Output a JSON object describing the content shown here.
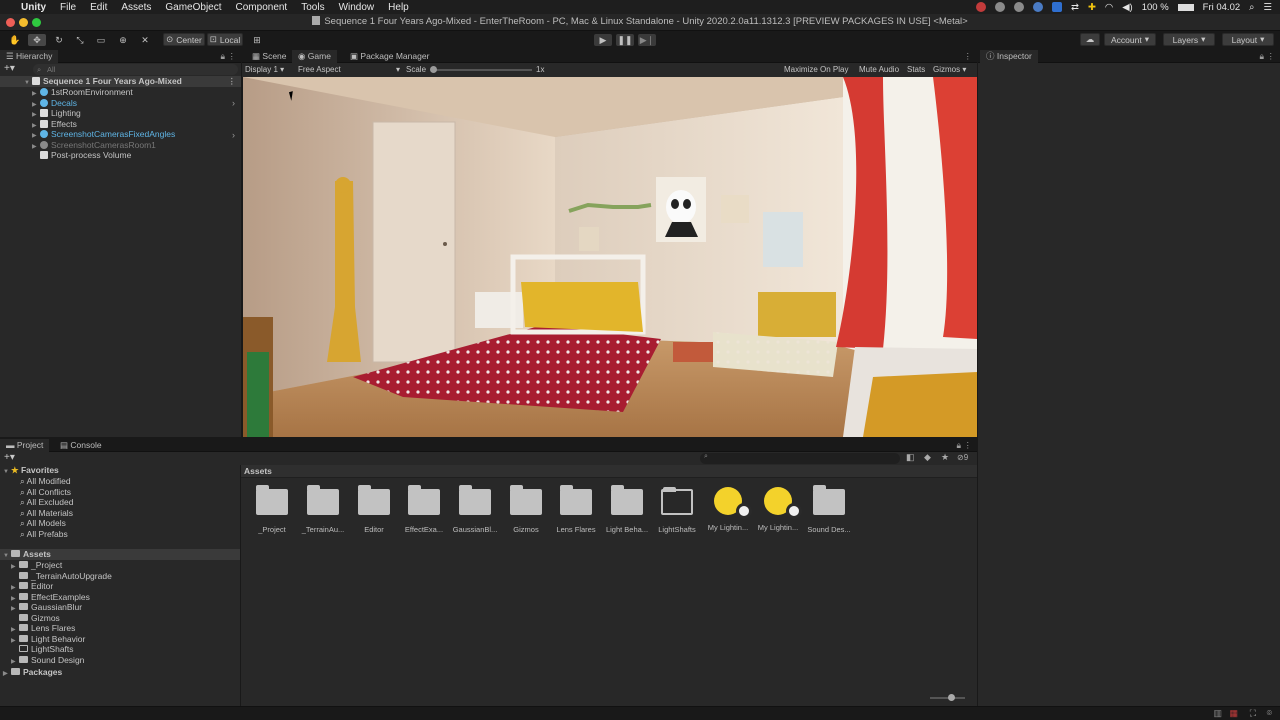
{
  "menubar": {
    "app": "Unity",
    "items": [
      "File",
      "Edit",
      "Assets",
      "GameObject",
      "Component",
      "Tools",
      "Window",
      "Help"
    ],
    "battery": "100 %",
    "clock": "Fri 04.02"
  },
  "window": {
    "title": "Sequence 1 Four Years Ago-Mixed - EnterTheRoom - PC, Mac & Linux Standalone - Unity 2020.2.0a11.1312.3 [PREVIEW PACKAGES IN USE] <Metal>"
  },
  "toolbar": {
    "pivot": "Center",
    "space": "Local",
    "account": "Account",
    "layers": "Layers",
    "layout": "Layout"
  },
  "hierarchy": {
    "tab": "Hierarchy",
    "search_placeholder": "All",
    "scene": "Sequence 1 Four Years Ago-Mixed",
    "items": [
      "1stRoomEnvironment",
      "Decals",
      "Lighting",
      "Effects",
      "ScreenshotCamerasFixedAngles",
      "ScreenshotCamerasRoom1",
      "Post-process Volume"
    ]
  },
  "center_tabs": [
    "Scene",
    "Game",
    "Package Manager"
  ],
  "game_bar": {
    "display": "Display 1",
    "aspect": "Free Aspect",
    "scale_label": "Scale",
    "scale_value": "1x",
    "maximize": "Maximize On Play",
    "mute": "Mute Audio",
    "stats": "Stats",
    "gizmos": "Gizmos"
  },
  "inspector": {
    "tab": "Inspector"
  },
  "project": {
    "tabs": [
      "Project",
      "Console"
    ],
    "favorites_label": "Favorites",
    "favorites": [
      "All Modified",
      "All Conflicts",
      "All Excluded",
      "All Materials",
      "All Models",
      "All Prefabs"
    ],
    "assets_label": "Assets",
    "tree": [
      "_Project",
      "_TerrainAutoUpgrade",
      "Editor",
      "EffectExamples",
      "GaussianBlur",
      "Gizmos",
      "Lens Flares",
      "Light Behavior",
      "LightShafts",
      "Sound Design"
    ],
    "packages_label": "Packages",
    "breadcrumb": "Assets",
    "hidden_count": "9",
    "grid": [
      "_Project",
      "_TerrainAu...",
      "Editor",
      "EffectExa...",
      "GaussianBl...",
      "Gizmos",
      "Lens Flares",
      "Light Beha...",
      "LightShafts",
      "My Lightin...",
      "My Lightin...",
      "Sound Des..."
    ]
  }
}
